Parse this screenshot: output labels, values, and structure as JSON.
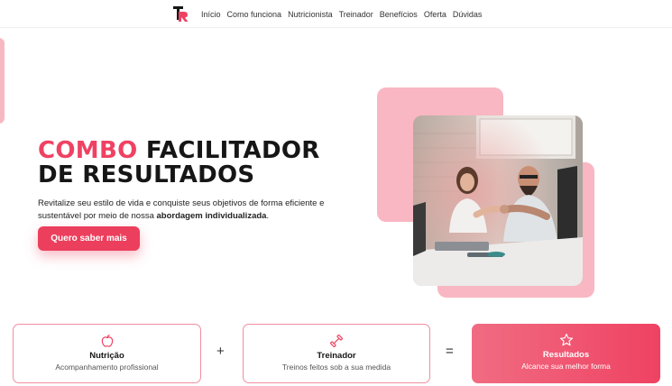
{
  "nav": {
    "logo_text": "R",
    "links": [
      "Início",
      "Como funciona",
      "Nutricionista",
      "Treinador",
      "Benefícios",
      "Oferta",
      "Dúvidas"
    ]
  },
  "hero": {
    "title_accent": "COMBO",
    "title_line1_rest": "FACILITADOR",
    "title_line2": "DE RESULTADOS",
    "desc_part1": "Revitalize seu estilo de vida e conquiste seus objetivos de forma eficiente e sustentável por meio de nossa ",
    "desc_bold": "abordagem individualizada",
    "desc_end": ".",
    "cta_label": "Quero saber mais"
  },
  "steps": [
    {
      "title": "Nutrição",
      "subtitle": "Acompanhamento profissional",
      "icon": "apple-icon"
    },
    {
      "title": "Treinador",
      "subtitle": "Treinos feitos sob a sua medida",
      "icon": "dumbbell-icon"
    },
    {
      "title": "Resultados",
      "subtitle": "Alcance sua melhor forma",
      "icon": "star-icon"
    }
  ],
  "operators": {
    "plus": "+",
    "equals": "="
  },
  "colors": {
    "accent": "#ef4262",
    "deco_pink": "#f8b7c2"
  }
}
